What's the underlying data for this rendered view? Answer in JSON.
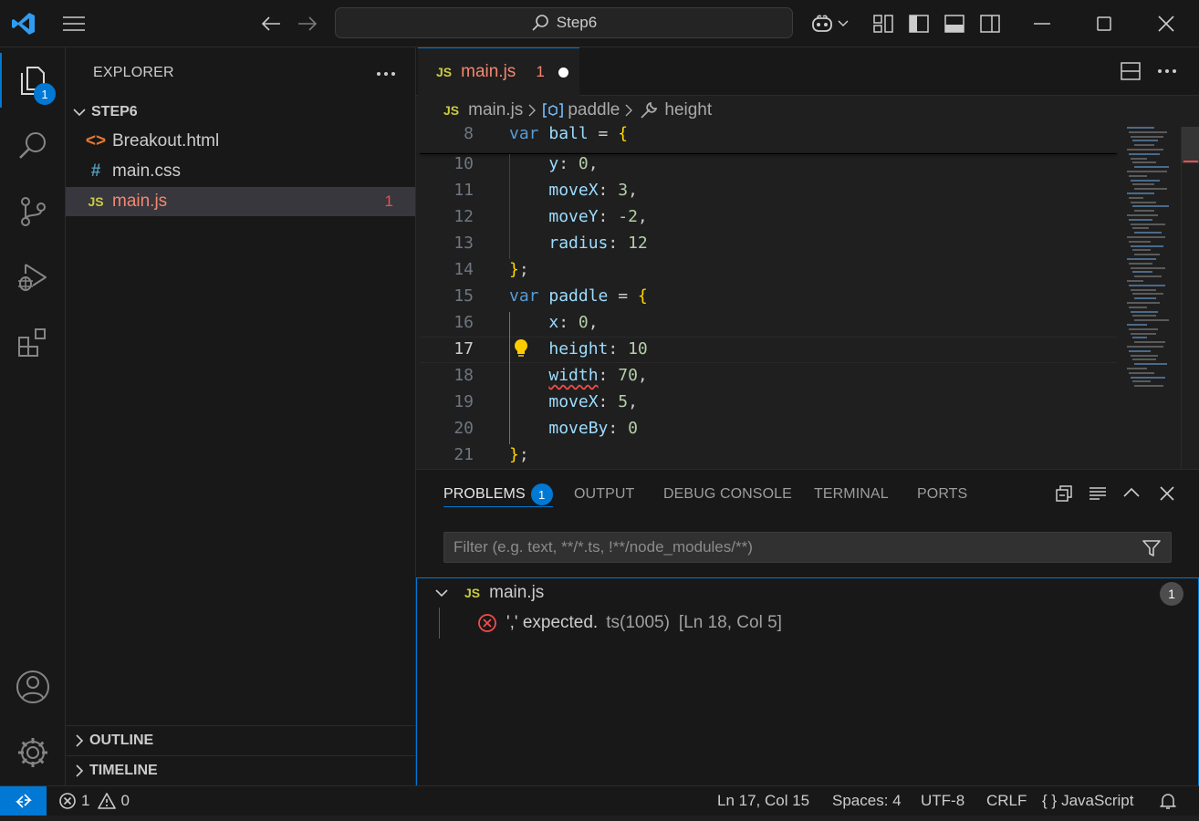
{
  "titlebar": {
    "search_text": "Step6"
  },
  "activity": {
    "explorer_badge": "1"
  },
  "sidebar": {
    "title": "EXPLORER",
    "folder": "STEP6",
    "files": [
      {
        "icon": "<>",
        "name": "Breakout.html",
        "count": ""
      },
      {
        "icon": "#",
        "name": "main.css",
        "count": ""
      },
      {
        "icon": "JS",
        "name": "main.js",
        "count": "1"
      }
    ],
    "outline": "OUTLINE",
    "timeline": "TIMELINE"
  },
  "editor": {
    "tab": {
      "icon": "JS",
      "name": "main.js",
      "problems": "1"
    },
    "breadcrumb": {
      "file_icon": "JS",
      "file": "main.js",
      "symbol1": "paddle",
      "symbol2": "height"
    },
    "lines": [
      {
        "n": "8",
        "tokens": [
          [
            "kw",
            "var "
          ],
          [
            "id",
            "ball"
          ],
          [
            "pu",
            " = "
          ],
          [
            "br",
            "{"
          ]
        ]
      },
      {
        "n": "10",
        "tokens": [
          [
            "pu",
            "    "
          ],
          [
            "id",
            "y"
          ],
          [
            "pu",
            ": "
          ],
          [
            "nu",
            "0"
          ],
          [
            "pu",
            ","
          ]
        ]
      },
      {
        "n": "11",
        "tokens": [
          [
            "pu",
            "    "
          ],
          [
            "id",
            "moveX"
          ],
          [
            "pu",
            ": "
          ],
          [
            "nu",
            "3"
          ],
          [
            "pu",
            ","
          ]
        ]
      },
      {
        "n": "12",
        "tokens": [
          [
            "pu",
            "    "
          ],
          [
            "id",
            "moveY"
          ],
          [
            "pu",
            ": "
          ],
          [
            "nu",
            "-2"
          ],
          [
            "pu",
            ","
          ]
        ]
      },
      {
        "n": "13",
        "tokens": [
          [
            "pu",
            "    "
          ],
          [
            "id",
            "radius"
          ],
          [
            "pu",
            ": "
          ],
          [
            "nu",
            "12"
          ]
        ]
      },
      {
        "n": "14",
        "tokens": [
          [
            "br",
            "}"
          ],
          [
            "pu",
            ";"
          ]
        ]
      },
      {
        "n": "15",
        "tokens": [
          [
            "kw",
            "var "
          ],
          [
            "id",
            "paddle"
          ],
          [
            "pu",
            " = "
          ],
          [
            "br",
            "{"
          ]
        ]
      },
      {
        "n": "16",
        "tokens": [
          [
            "pu",
            "    "
          ],
          [
            "id",
            "x"
          ],
          [
            "pu",
            ": "
          ],
          [
            "nu",
            "0"
          ],
          [
            "pu",
            ","
          ]
        ]
      },
      {
        "n": "17",
        "tokens": [
          [
            "pu",
            "    "
          ],
          [
            "id",
            "height"
          ],
          [
            "pu",
            ": "
          ],
          [
            "nu",
            "10"
          ]
        ]
      },
      {
        "n": "18",
        "tokens": [
          [
            "pu",
            "    "
          ],
          [
            "id sq",
            "width"
          ],
          [
            "pu",
            ": "
          ],
          [
            "nu",
            "70"
          ],
          [
            "pu",
            ","
          ]
        ]
      },
      {
        "n": "19",
        "tokens": [
          [
            "pu",
            "    "
          ],
          [
            "id",
            "moveX"
          ],
          [
            "pu",
            ": "
          ],
          [
            "nu",
            "5"
          ],
          [
            "pu",
            ","
          ]
        ]
      },
      {
        "n": "20",
        "tokens": [
          [
            "pu",
            "    "
          ],
          [
            "id",
            "moveBy"
          ],
          [
            "pu",
            ": "
          ],
          [
            "nu",
            "0"
          ]
        ]
      },
      {
        "n": "21",
        "tokens": [
          [
            "br",
            "}"
          ],
          [
            "pu",
            ";"
          ]
        ]
      }
    ],
    "current_line": "17"
  },
  "panel": {
    "tabs": [
      "PROBLEMS",
      "OUTPUT",
      "DEBUG CONSOLE",
      "TERMINAL",
      "PORTS"
    ],
    "problems_badge": "1",
    "filter_placeholder": "Filter (e.g. text, **/*.ts, !**/node_modules/**)",
    "file": {
      "icon": "JS",
      "name": "main.js",
      "count": "1"
    },
    "problem": {
      "message": "',' expected.",
      "source": "ts(1005)",
      "location": "[Ln 18, Col 5]"
    }
  },
  "status": {
    "errors": "1",
    "warnings": "0",
    "position": "Ln 17, Col 15",
    "spaces": "Spaces: 4",
    "encoding": "UTF-8",
    "eol": "CRLF",
    "braces": "{ }",
    "language": "JavaScript"
  },
  "colors": {
    "accent": "#0078d4",
    "error": "#f14c4c",
    "js_icon": "#cbcb41"
  }
}
